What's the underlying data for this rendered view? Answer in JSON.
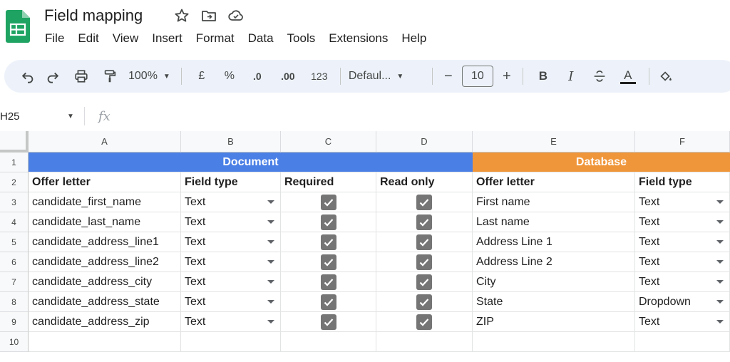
{
  "app": {
    "title": "Field mapping",
    "menu": [
      "File",
      "Edit",
      "View",
      "Insert",
      "Format",
      "Data",
      "Tools",
      "Extensions",
      "Help"
    ]
  },
  "toolbar": {
    "zoom": "100%",
    "currency": "£",
    "percent": "%",
    "decrease_decimal": ".0",
    "increase_decimal": ".00",
    "number_format": "123",
    "font": "Defaul...",
    "font_size": "10",
    "minus": "−",
    "plus": "+",
    "bold": "B",
    "italic": "I",
    "text_color": "A"
  },
  "formula_bar": {
    "cell_ref": "H25",
    "fx": "fx"
  },
  "grid": {
    "columns": [
      "A",
      "B",
      "C",
      "D",
      "E",
      "F"
    ],
    "rows": [
      "1",
      "2",
      "3",
      "4",
      "5",
      "6",
      "7",
      "8",
      "9",
      "10"
    ],
    "bands": {
      "document": "Document",
      "database": "Database",
      "document_color": "#4a7fe6",
      "database_color": "#f0963a"
    },
    "headers": [
      "Offer letter",
      "Field type",
      "Required",
      "Read only",
      "Offer letter",
      "Field type"
    ],
    "data": [
      {
        "field": "candidate_first_name",
        "type": "Text",
        "required": true,
        "read_only": true,
        "db_field": "First name",
        "db_type": "Text"
      },
      {
        "field": "candidate_last_name",
        "type": "Text",
        "required": true,
        "read_only": true,
        "db_field": "Last name",
        "db_type": "Text"
      },
      {
        "field": "candidate_address_line1",
        "type": "Text",
        "required": true,
        "read_only": true,
        "db_field": "Address Line 1",
        "db_type": "Text"
      },
      {
        "field": "candidate_address_line2",
        "type": "Text",
        "required": true,
        "read_only": true,
        "db_field": "Address Line 2",
        "db_type": "Text"
      },
      {
        "field": "candidate_address_city",
        "type": "Text",
        "required": true,
        "read_only": true,
        "db_field": "City",
        "db_type": "Text"
      },
      {
        "field": "candidate_address_state",
        "type": "Text",
        "required": true,
        "read_only": true,
        "db_field": "State",
        "db_type": "Dropdown"
      },
      {
        "field": "candidate_address_zip",
        "type": "Text",
        "required": true,
        "read_only": true,
        "db_field": "ZIP",
        "db_type": "Text"
      }
    ]
  }
}
